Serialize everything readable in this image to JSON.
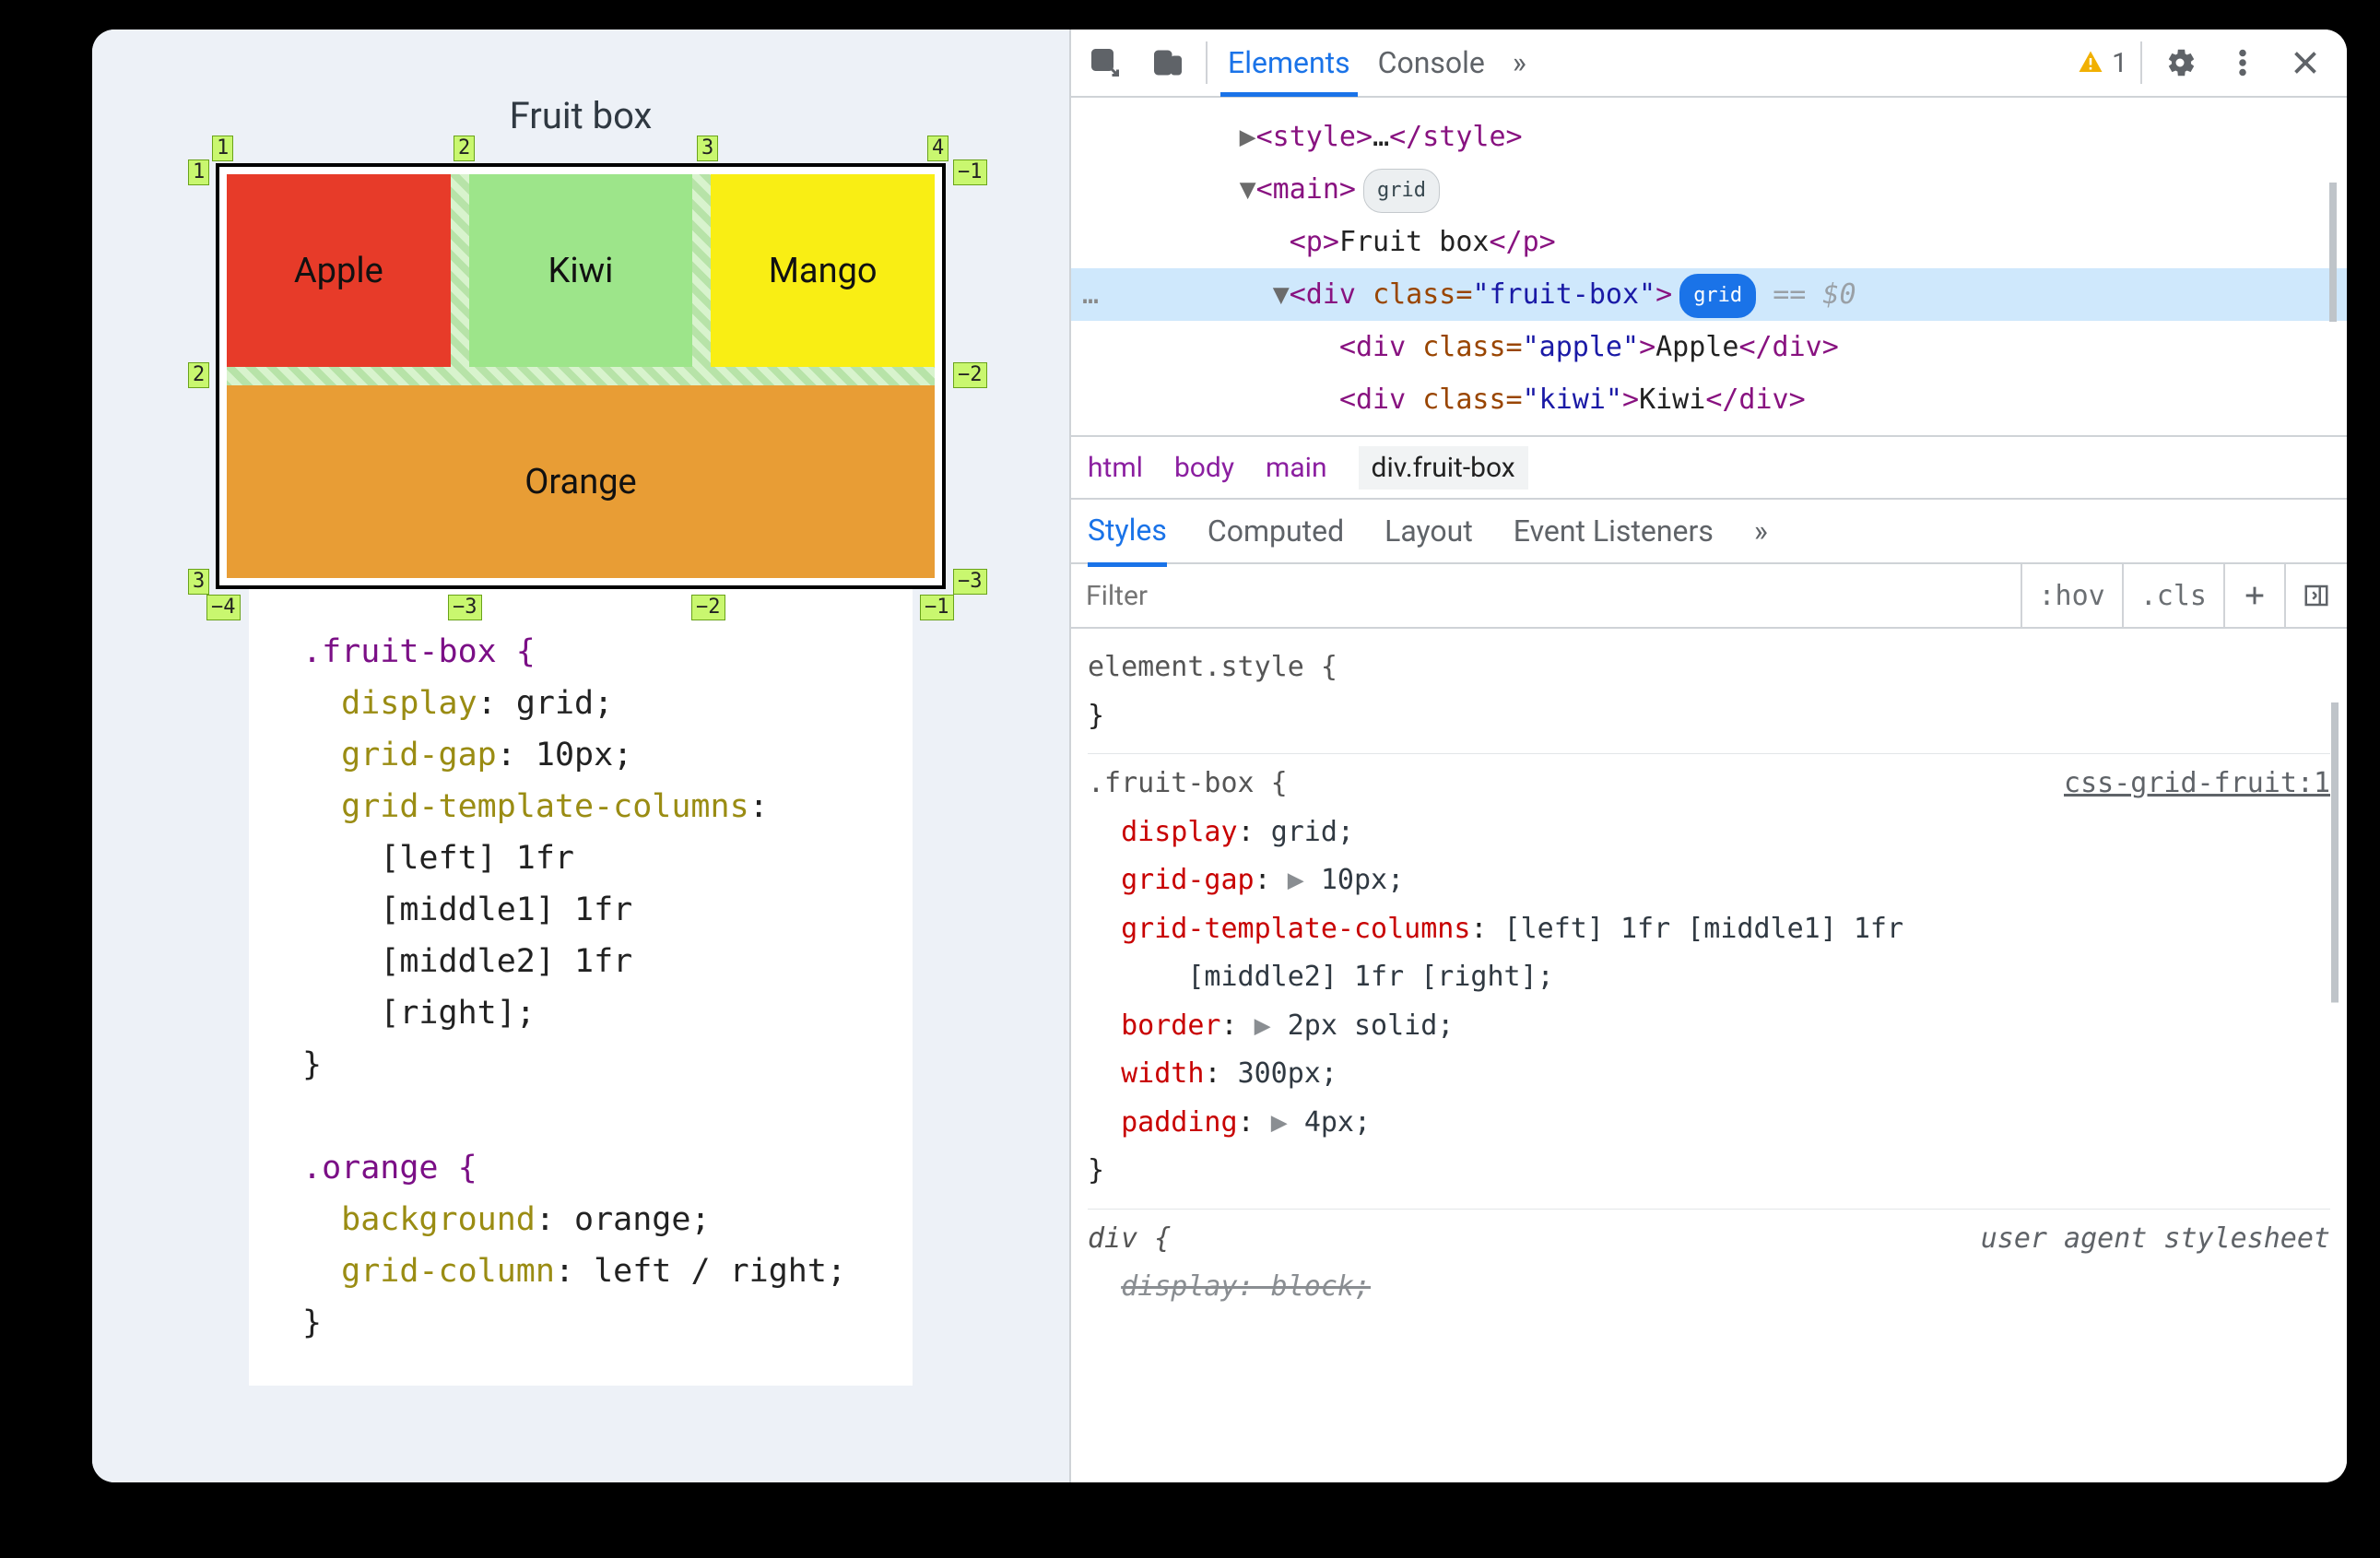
{
  "page": {
    "title": "Fruit box",
    "cells": {
      "apple": "Apple",
      "kiwi": "Kiwi",
      "mango": "Mango",
      "orange": "Orange"
    },
    "grid_labels": {
      "top": [
        "1",
        "2",
        "3",
        "4"
      ],
      "bottom": [
        "−4",
        "−3",
        "−2",
        "−1"
      ],
      "left": [
        "1",
        "2",
        "3"
      ],
      "right": [
        "−1",
        "−2",
        "−3"
      ]
    },
    "css_snippet": {
      "rule1": {
        "selector": ".fruit-box {",
        "p1": "display",
        "v1": "grid;",
        "p2": "grid-gap",
        "v2": "10px;",
        "p3": "grid-template-columns",
        "v3": ":",
        "l1": "[left] 1fr",
        "l2": "[middle1] 1fr",
        "l3": "[middle2] 1fr",
        "l4": "[right];",
        "close": "}"
      },
      "rule2": {
        "selector": ".orange {",
        "p1": "background",
        "v1": "orange;",
        "p2": "grid-column",
        "v2": "left / right;",
        "close": "}"
      }
    }
  },
  "devtools": {
    "tabs": {
      "elements": "Elements",
      "console": "Console",
      "more": "»"
    },
    "warning_count": "1",
    "dom": {
      "line1_a": "▶",
      "line1_b": "<style>",
      "line1_c": "…",
      "line1_d": "</style>",
      "line2_a": "▼",
      "line2_b": "<main>",
      "line2_badge": "grid",
      "line3": "<p>",
      "line3_txt": "Fruit box",
      "line3_c": "</p>",
      "sel_prefix": "…",
      "sel_tri": "▼",
      "sel_tag_open": "<div ",
      "sel_attr": "class=",
      "sel_val": "\"fruit-box\"",
      "sel_tag_close": ">",
      "sel_badge": "grid",
      "sel_eq": " == ",
      "sel_dollar": "$0",
      "child1_open": "<div ",
      "child1_attr": "class=",
      "child1_val": "\"apple\"",
      "child1_mid": ">",
      "child1_txt": "Apple",
      "child1_close": "</div>",
      "child2_open": "<div ",
      "child2_attr": "class=",
      "child2_val": "\"kiwi\"",
      "child2_mid": ">",
      "child2_txt": "Kiwi",
      "child2_close": "</div>"
    },
    "breadcrumb": [
      "html",
      "body",
      "main",
      "div.fruit-box"
    ],
    "subtabs": {
      "styles": "Styles",
      "computed": "Computed",
      "layout": "Layout",
      "events": "Event Listeners",
      "more": "»"
    },
    "filter": {
      "placeholder": "Filter",
      "hov": ":hov",
      "cls": ".cls"
    },
    "styles": {
      "element_style": "element.style {",
      "close": "}",
      "rule_fruit": {
        "selector": ".fruit-box {",
        "source": "css-grid-fruit:1",
        "p1": "display",
        "v1": "grid;",
        "p2": "grid-gap",
        "v2": "10px;",
        "p3": "grid-template-columns",
        "v3": "[left] 1fr [middle1] 1fr",
        "v3b": "[middle2] 1fr [right];",
        "p4": "border",
        "v4": "2px solid;",
        "p5": "width",
        "v5": "300px;",
        "p6": "padding",
        "v6": "4px;",
        "close": "}"
      },
      "rule_div": {
        "selector": "div {",
        "source": "user agent stylesheet",
        "p1": "display: block;"
      }
    }
  }
}
